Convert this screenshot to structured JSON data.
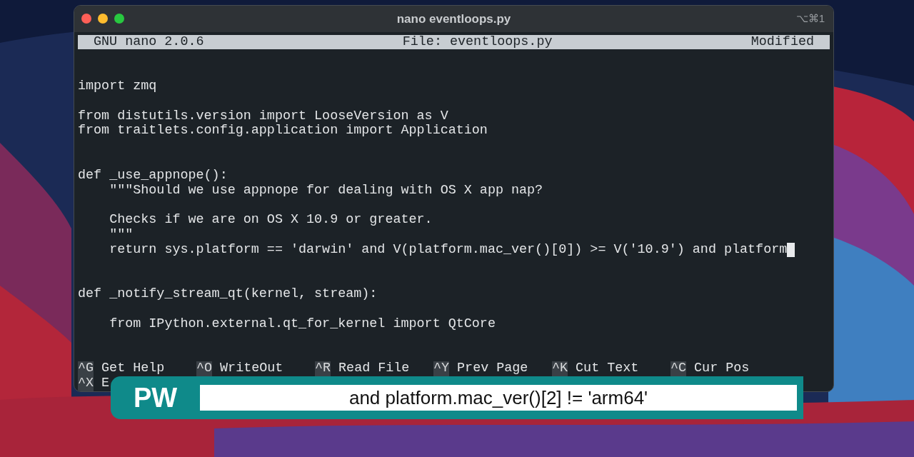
{
  "window": {
    "title": "nano eventloops.py",
    "shortcut": "⌥⌘1"
  },
  "nano_header": {
    "version": "GNU nano 2.0.6",
    "file": "File: eventloops.py",
    "status": "Modified"
  },
  "code_lines": [
    {
      "kind": "blank"
    },
    {
      "kind": "blank"
    },
    {
      "kind": "code",
      "text": "import zmq",
      "cursor": false
    },
    {
      "kind": "blank"
    },
    {
      "kind": "code",
      "text": "from distutils.version import LooseVersion as V",
      "cursor": false
    },
    {
      "kind": "code",
      "text": "from traitlets.config.application import Application",
      "cursor": false
    },
    {
      "kind": "blank"
    },
    {
      "kind": "blank"
    },
    {
      "kind": "code",
      "text": "def _use_appnope():",
      "cursor": false
    },
    {
      "kind": "code",
      "text": "    \"\"\"Should we use appnope for dealing with OS X app nap?",
      "cursor": false
    },
    {
      "kind": "blank"
    },
    {
      "kind": "code",
      "text": "    Checks if we are on OS X 10.9 or greater.",
      "cursor": false
    },
    {
      "kind": "code",
      "text": "    \"\"\"",
      "cursor": false
    },
    {
      "kind": "code",
      "text": "    return sys.platform == 'darwin' and V(platform.mac_ver()[0]) >= V('10.9') and platform",
      "cursor": true
    },
    {
      "kind": "blank"
    },
    {
      "kind": "blank"
    },
    {
      "kind": "code",
      "text": "def _notify_stream_qt(kernel, stream):",
      "cursor": false
    },
    {
      "kind": "blank"
    },
    {
      "kind": "code",
      "text": "    from IPython.external.qt_for_kernel import QtCore",
      "cursor": false
    }
  ],
  "shortcuts": [
    [
      {
        "key": "^G",
        "label": "Get Help"
      },
      {
        "key": "^O",
        "label": "WriteOut"
      },
      {
        "key": "^R",
        "label": "Read File"
      },
      {
        "key": "^Y",
        "label": "Prev Page"
      },
      {
        "key": "^K",
        "label": "Cut Text"
      },
      {
        "key": "^C",
        "label": "Cur Pos"
      }
    ],
    [
      {
        "key": "^X",
        "label": "E"
      }
    ]
  ],
  "caption": {
    "badge": "PW",
    "text": "and platform.mac_ver()[2] != 'arm64'"
  }
}
